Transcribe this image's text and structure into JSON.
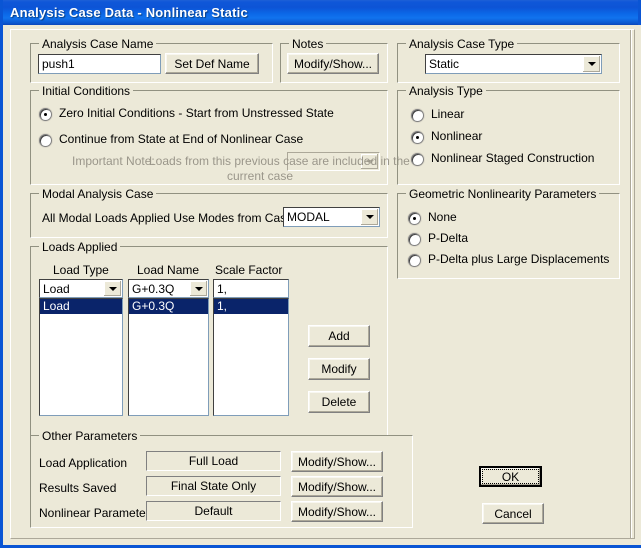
{
  "window": {
    "title": "Analysis Case Data - Nonlinear Static"
  },
  "analysis_case_name": {
    "group_label": "Analysis Case Name",
    "value": "push1",
    "set_def_name_button": "Set Def Name"
  },
  "notes": {
    "group_label": "Notes",
    "modify_show_button": "Modify/Show..."
  },
  "analysis_case_type": {
    "group_label": "Analysis Case Type",
    "selected": "Static",
    "options": [
      "Static"
    ]
  },
  "initial_conditions": {
    "group_label": "Initial Conditions",
    "zero_option": "Zero Initial Conditions - Start from Unstressed State",
    "continue_option": "Continue from State at End of Nonlinear Case",
    "continue_case_value": "",
    "note_label": "Important Note:",
    "note_line1": "Loads from this previous case are included in the",
    "note_line2": "current case",
    "selected": "zero"
  },
  "analysis_type": {
    "group_label": "Analysis Type",
    "options": [
      "Linear",
      "Nonlinear",
      "Nonlinear Staged Construction"
    ],
    "selected_index": 1
  },
  "modal_analysis_case": {
    "group_label": "Modal Analysis Case",
    "label": "All Modal Loads Applied Use Modes from Case",
    "selected": "MODAL"
  },
  "geometric_nonlinearity": {
    "group_label": "Geometric Nonlinearity Parameters",
    "options": [
      "None",
      "P-Delta",
      "P-Delta plus Large Displacements"
    ],
    "selected_index": 0
  },
  "loads_applied": {
    "group_label": "Loads Applied",
    "headers": [
      "Load Type",
      "Load Name",
      "Scale Factor"
    ],
    "editor": {
      "load_type": "Load",
      "load_name": "G+0.3Q",
      "scale_factor": "1,"
    },
    "rows": [
      {
        "load_type": "Load",
        "load_name": "G+0.3Q",
        "scale_factor": "1,",
        "selected": true
      }
    ],
    "add_button": "Add",
    "modify_button": "Modify",
    "delete_button": "Delete"
  },
  "other_parameters": {
    "group_label": "Other Parameters",
    "rows": [
      {
        "label": "Load Application",
        "value": "Full Load",
        "button": "Modify/Show..."
      },
      {
        "label": "Results Saved",
        "value": "Final State Only",
        "button": "Modify/Show..."
      },
      {
        "label": "Nonlinear Parameters",
        "value": "Default",
        "button": "Modify/Show..."
      }
    ]
  },
  "actions": {
    "ok_button": "OK",
    "cancel_button": "Cancel"
  },
  "colors": {
    "titlebar_blue": "#0d54d6",
    "dialog_face": "#ece9d8",
    "selection_blue": "#0a246a"
  }
}
